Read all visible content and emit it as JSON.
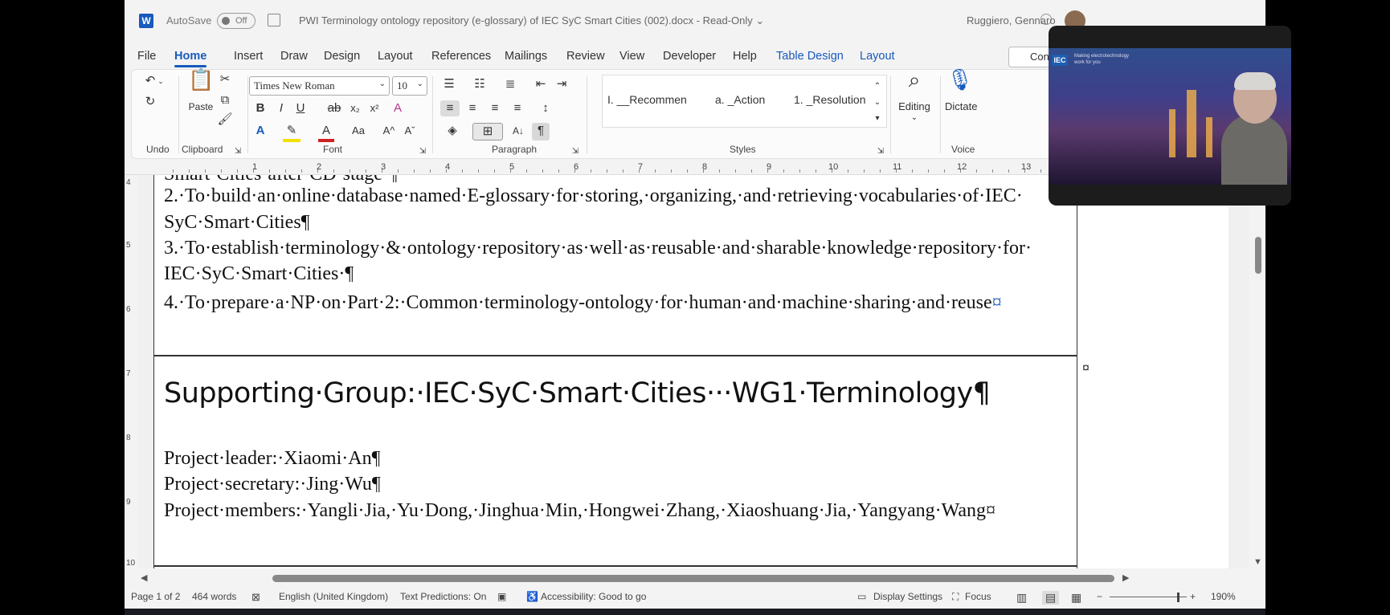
{
  "titlebar": {
    "app_icon": "W",
    "autosave_label": "AutoSave",
    "autosave_state": "Off",
    "document_title": "PWI Terminology ontology repository (e-glossary) of IEC SyC Smart Cities (002).docx - Read-Only ⌄",
    "user_name": "Ruggiero, Gennaro"
  },
  "menu": [
    "File",
    "Home",
    "Insert",
    "Draw",
    "Design",
    "Layout",
    "References",
    "Mailings",
    "Review",
    "View",
    "Developer",
    "Help",
    "Table Design",
    "Layout"
  ],
  "comments_label": "Con",
  "ribbon": {
    "groups": {
      "undo": "Undo",
      "clipboard": "Clipboard",
      "font": "Font",
      "paragraph": "Paragraph",
      "styles": "Styles",
      "voice": "Voice"
    },
    "paste_label": "Paste",
    "font_name": "Times New Roman",
    "font_size": "10",
    "styles": [
      "I. __Recommen",
      "a. _Action",
      "1. _Resolution"
    ],
    "editing_label": "Editing",
    "dictate_label": "Dictate"
  },
  "ruler": {
    "numbers": [
      "1",
      "2",
      "3",
      "4",
      "5",
      "6",
      "7",
      "8",
      "9",
      "10",
      "11",
      "12",
      "13"
    ],
    "vertical_numbers": [
      "4",
      "5",
      "6",
      "7",
      "8",
      "9",
      "10"
    ]
  },
  "document": {
    "line_top": "Smart·Cities·after·CD·stage·¶",
    "item2_a": "2.·To·build·an·online·database·named·E-glossary·for·storing,·organizing,·and·retrieving·vocabularies·of·IEC·",
    "item2_b": "SyC·Smart·Cities¶",
    "item3_a": "3.·To·establish·terminology·&·ontology·repository·as·well·as·reusable·and·sharable·knowledge·repository·for·",
    "item3_b": "IEC·SyC·Smart·Cities·¶",
    "item4": "4.·To·prepare·a·NP·on·Part·2:·Common·terminology-ontology·for·human·and·machine·sharing·and·reuse",
    "cell_end_mark": "¤",
    "heading": "Supporting·Group:·IEC·SyC·Smart·Cities···WG1·Terminology¶",
    "leader": "Project·leader:·Xiaomi·An¶",
    "secretary": "Project·secretary:·Jing·Wu¶",
    "members": "Project·members:·Yangli·Jia,·Yu·Dong,·Jinghua·Min,·Hongwei·Zhang,·Xiaoshuang·Jia,·Yangyang·Wang"
  },
  "status": {
    "page": "Page 1 of 2",
    "words": "464 words",
    "language": "English (United Kingdom)",
    "text_predictions": "Text Predictions: On",
    "accessibility": "Accessibility: Good to go",
    "display_settings": "Display Settings",
    "focus": "Focus",
    "zoom": "190%"
  },
  "video": {
    "banner_text": "Making electrotechnology work for you",
    "logo": "IEC"
  },
  "colors": {
    "accent": "#185abd",
    "window_bg": "#f3f3f3",
    "page_bg": "#ffffff"
  }
}
